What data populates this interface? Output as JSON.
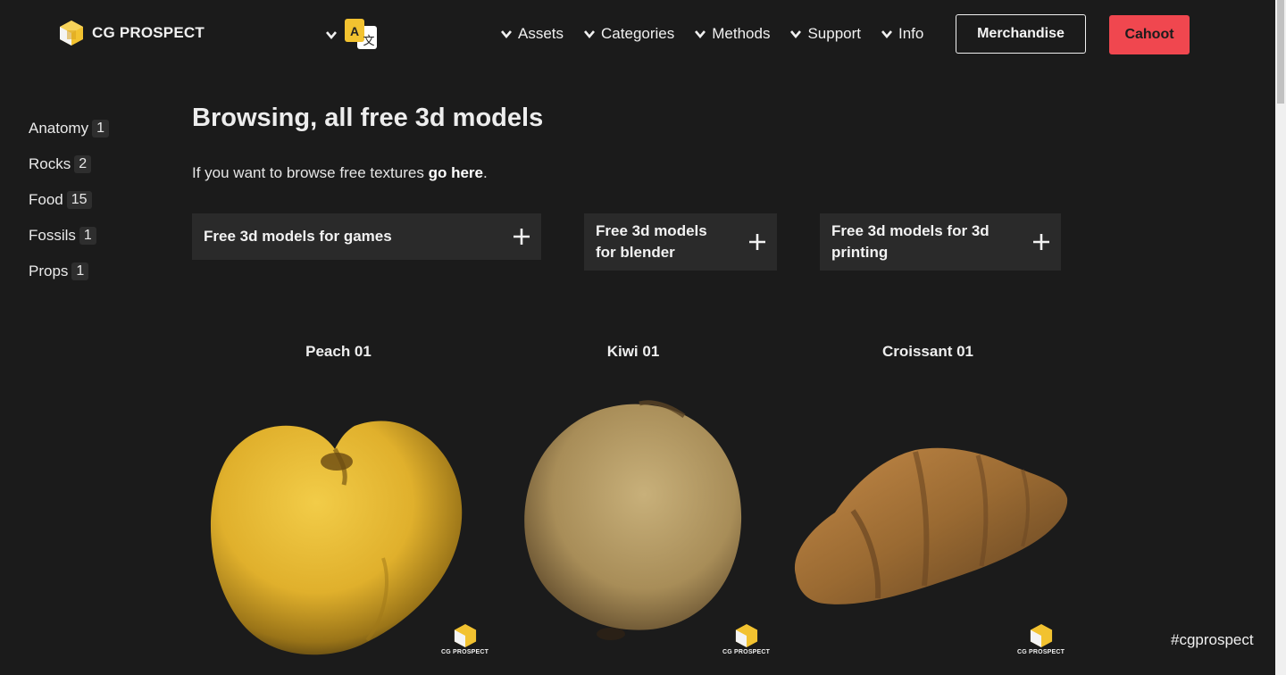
{
  "header": {
    "logo_text": "CG PROSPECT",
    "lang_icon": "translate-icon",
    "nav": [
      {
        "label": "Assets"
      },
      {
        "label": "Categories"
      },
      {
        "label": "Methods"
      },
      {
        "label": "Support"
      },
      {
        "label": "Info"
      }
    ],
    "merch_label": "Merchandise",
    "cahoot_label": "Cahoot"
  },
  "sidebar": {
    "items": [
      {
        "label": "Anatomy",
        "count": "1"
      },
      {
        "label": "Rocks",
        "count": "2"
      },
      {
        "label": "Food",
        "count": "15"
      },
      {
        "label": "Fossils",
        "count": "1"
      },
      {
        "label": "Props",
        "count": "1"
      }
    ]
  },
  "main": {
    "title": "Browsing, all free 3d models",
    "intro_prefix": "If you want to browse free textures ",
    "intro_link": "go here",
    "intro_suffix": ".",
    "accordions": [
      {
        "label": "Free 3d models for games"
      },
      {
        "label": "Free 3d models for blender"
      },
      {
        "label": "Free 3d models for 3d printing"
      }
    ],
    "models": [
      {
        "title": "Peach 01"
      },
      {
        "title": "Kiwi 01"
      },
      {
        "title": "Croissant 01"
      }
    ],
    "watermark_text": "CG PROSPECT"
  },
  "footer": {
    "hashtag": "#cgprospect"
  },
  "colors": {
    "background": "#1b1b1b",
    "accent_red": "#f0474f",
    "logo_yellow": "#f2c230",
    "panel": "#2a2a2a"
  }
}
